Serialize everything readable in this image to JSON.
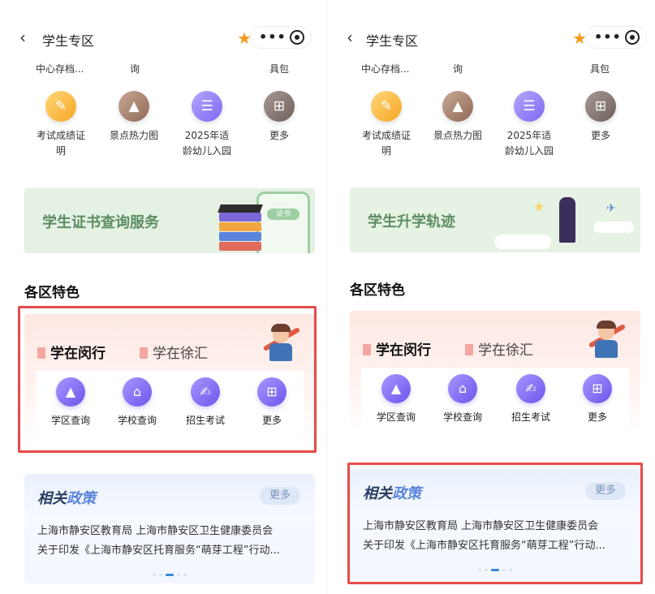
{
  "phones": [
    {
      "header": {
        "title": "学生专区",
        "back_icon": "chevron-left-icon",
        "favorite_icon": "star-icon",
        "more_label": "•••",
        "target_icon": "target-icon"
      },
      "prev_row": [
        "中心存档...",
        "询",
        "具包"
      ],
      "services": [
        {
          "label_line1": "考试成绩证",
          "label_line2": "明",
          "icon": "certificate-icon",
          "glyph": "✎"
        },
        {
          "label_line1": "景点热力图",
          "label_line2": "",
          "icon": "mountain-icon",
          "glyph": "▲"
        },
        {
          "label_line1": "2025年适",
          "label_line2": "龄幼儿入园",
          "icon": "clipboard-icon",
          "glyph": "☰"
        },
        {
          "label_line1": "更多",
          "label_line2": "",
          "icon": "grid-icon",
          "glyph": "⊞"
        }
      ],
      "banner": {
        "title": "学生证书查询服务",
        "badge": "证书"
      },
      "regions": {
        "title": "各区特色",
        "tabs": [
          "学在闵行",
          "学在徐汇"
        ],
        "items": [
          {
            "label": "学区查询",
            "icon": "graduation-cap-icon",
            "glyph": "🎓"
          },
          {
            "label": "学校查询",
            "icon": "school-icon",
            "glyph": "⌂"
          },
          {
            "label": "招生考试",
            "icon": "exam-icon",
            "glyph": "✍"
          },
          {
            "label": "更多",
            "icon": "grid-icon",
            "glyph": "⊞"
          }
        ]
      },
      "policy": {
        "title_a": "相关",
        "title_b": "政策",
        "more": "更多",
        "line1": "上海市静安区教育局 上海市静安区卫生健康委员会",
        "line2": "关于印发《上海市静安区托育服务“萌芽工程”行动..."
      }
    },
    {
      "header": {
        "title": "学生专区",
        "back_icon": "chevron-left-icon",
        "favorite_icon": "star-icon",
        "more_label": "•••",
        "target_icon": "target-icon"
      },
      "prev_row": [
        "中心存档...",
        "询",
        "具包"
      ],
      "services": [
        {
          "label_line1": "考试成绩证",
          "label_line2": "明",
          "icon": "certificate-icon",
          "glyph": "✎"
        },
        {
          "label_line1": "景点热力图",
          "label_line2": "",
          "icon": "mountain-icon",
          "glyph": "▲"
        },
        {
          "label_line1": "2025年适",
          "label_line2": "龄幼儿入园",
          "icon": "clipboard-icon",
          "glyph": "☰"
        },
        {
          "label_line1": "更多",
          "label_line2": "",
          "icon": "grid-icon",
          "glyph": "⊞"
        }
      ],
      "banner": {
        "title": "学生升学轨迹"
      },
      "regions": {
        "title": "各区特色",
        "tabs": [
          "学在闵行",
          "学在徐汇"
        ],
        "items": [
          {
            "label": "学区查询",
            "icon": "graduation-cap-icon",
            "glyph": "🎓"
          },
          {
            "label": "学校查询",
            "icon": "school-icon",
            "glyph": "⌂"
          },
          {
            "label": "招生考试",
            "icon": "exam-icon",
            "glyph": "✍"
          },
          {
            "label": "更多",
            "icon": "grid-icon",
            "glyph": "⊞"
          }
        ]
      },
      "policy": {
        "title_a": "相关",
        "title_b": "政策",
        "more": "更多",
        "line1": "上海市静安区教育局 上海市静安区卫生健康委员会",
        "line2": "关于印发《上海市静安区托育服务“萌芽工程”行动..."
      }
    }
  ],
  "colors": {
    "accent_orange": "#f39b1c",
    "highlight_red": "#e44b4b",
    "policy_blue": "#5b84dc",
    "banner_green": "#5d8d63"
  }
}
